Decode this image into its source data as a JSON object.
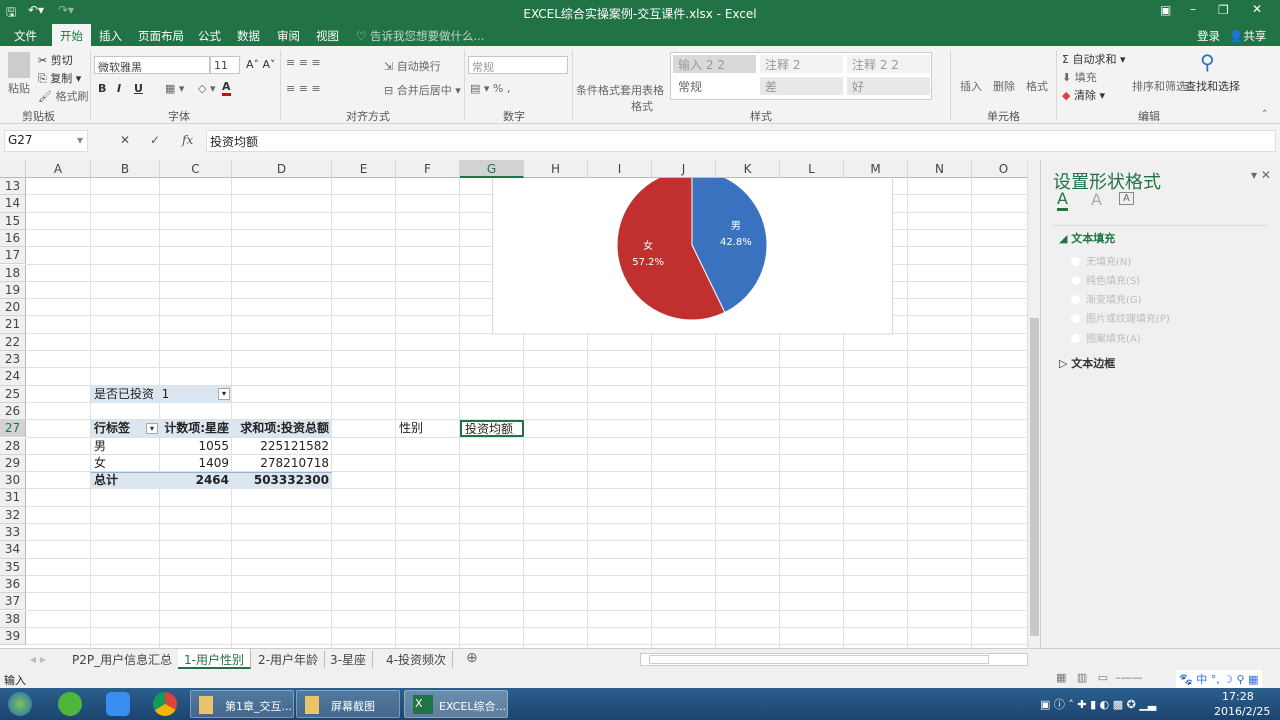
{
  "window": {
    "title": "EXCEL综合实操案例-交互课件.xlsx - Excel"
  },
  "ribbon_tabs": [
    "文件",
    "开始",
    "插入",
    "页面布局",
    "公式",
    "数据",
    "审阅",
    "视图"
  ],
  "tell_me": "告诉我您想要做什么...",
  "account": {
    "login": "登录",
    "share": "共享"
  },
  "clipboard": {
    "paste": "粘贴",
    "cut": "剪切",
    "copy": "复制",
    "format_painter": "格式刷",
    "group": "剪贴板"
  },
  "font": {
    "name": "微软雅黑",
    "size": "11",
    "group": "字体",
    "bold": "B",
    "italic": "I",
    "underline": "U"
  },
  "alignment": {
    "wrap": "自动换行",
    "merge": "合并后居中",
    "group": "对齐方式"
  },
  "number": {
    "format": "常规",
    "group": "数字",
    "percent": "%",
    "comma": ","
  },
  "styles": {
    "conditional": "条件格式",
    "table": "套用表格格式",
    "cells": [
      "输入 2 2",
      "注释 2",
      "注释 2 2",
      "常规",
      "差",
      "好"
    ],
    "group": "样式"
  },
  "cells_group": {
    "insert": "插入",
    "delete": "删除",
    "format": "格式",
    "group": "单元格"
  },
  "editing": {
    "autosum": "自动求和",
    "fill": "填充",
    "clear": "清除",
    "sort": "排序和筛选",
    "find": "查找和选择",
    "group": "编辑"
  },
  "formula_bar": {
    "name_box": "G27",
    "fx": "fx",
    "value": "投资均额"
  },
  "columns": [
    "A",
    "B",
    "C",
    "D",
    "E",
    "F",
    "G",
    "H",
    "I",
    "J",
    "K",
    "L",
    "M",
    "N",
    "O"
  ],
  "rows": [
    "13",
    "14",
    "15",
    "16",
    "17",
    "18",
    "19",
    "20",
    "21",
    "22",
    "23",
    "24",
    "25",
    "26",
    "27",
    "28",
    "29",
    "30",
    "31",
    "32",
    "33",
    "34",
    "35",
    "36",
    "37",
    "38",
    "39"
  ],
  "pivot": {
    "filter_label": "是否已投资",
    "filter_value": "1",
    "headers": [
      "行标签",
      "计数项:星座",
      "求和项:投资总额"
    ],
    "rows": [
      [
        "男",
        "1055",
        "225121582"
      ],
      [
        "女",
        "1409",
        "278210718"
      ]
    ],
    "total": [
      "总计",
      "2464",
      "503332300"
    ]
  },
  "cells": {
    "F27": "性别",
    "G27": "投资均额"
  },
  "chart_data": {
    "type": "pie",
    "categories": [
      "男",
      "女"
    ],
    "values": [
      42.8,
      57.2
    ],
    "labels": [
      "42.8%",
      "57.2%"
    ],
    "colors": [
      "#3a72c0",
      "#c0302e"
    ]
  },
  "pane": {
    "title": "设置形状格式",
    "section1": "文本填充",
    "options": [
      "无填充(N)",
      "纯色填充(S)",
      "渐变填充(G)",
      "图片或纹理填充(P)",
      "图案填充(A)"
    ],
    "section2": "文本边框"
  },
  "sheet_tabs": [
    "P2P_用户信息汇总",
    "1-用户性别",
    "2-用户年龄",
    "3-星座",
    "4-投资频次"
  ],
  "active_sheet": 1,
  "status": {
    "mode": "输入"
  },
  "taskbar": {
    "items": [
      "第1章_交互...",
      "屏幕截图",
      "EXCEL综合..."
    ],
    "time": "17:28",
    "date": "2016/2/25"
  }
}
